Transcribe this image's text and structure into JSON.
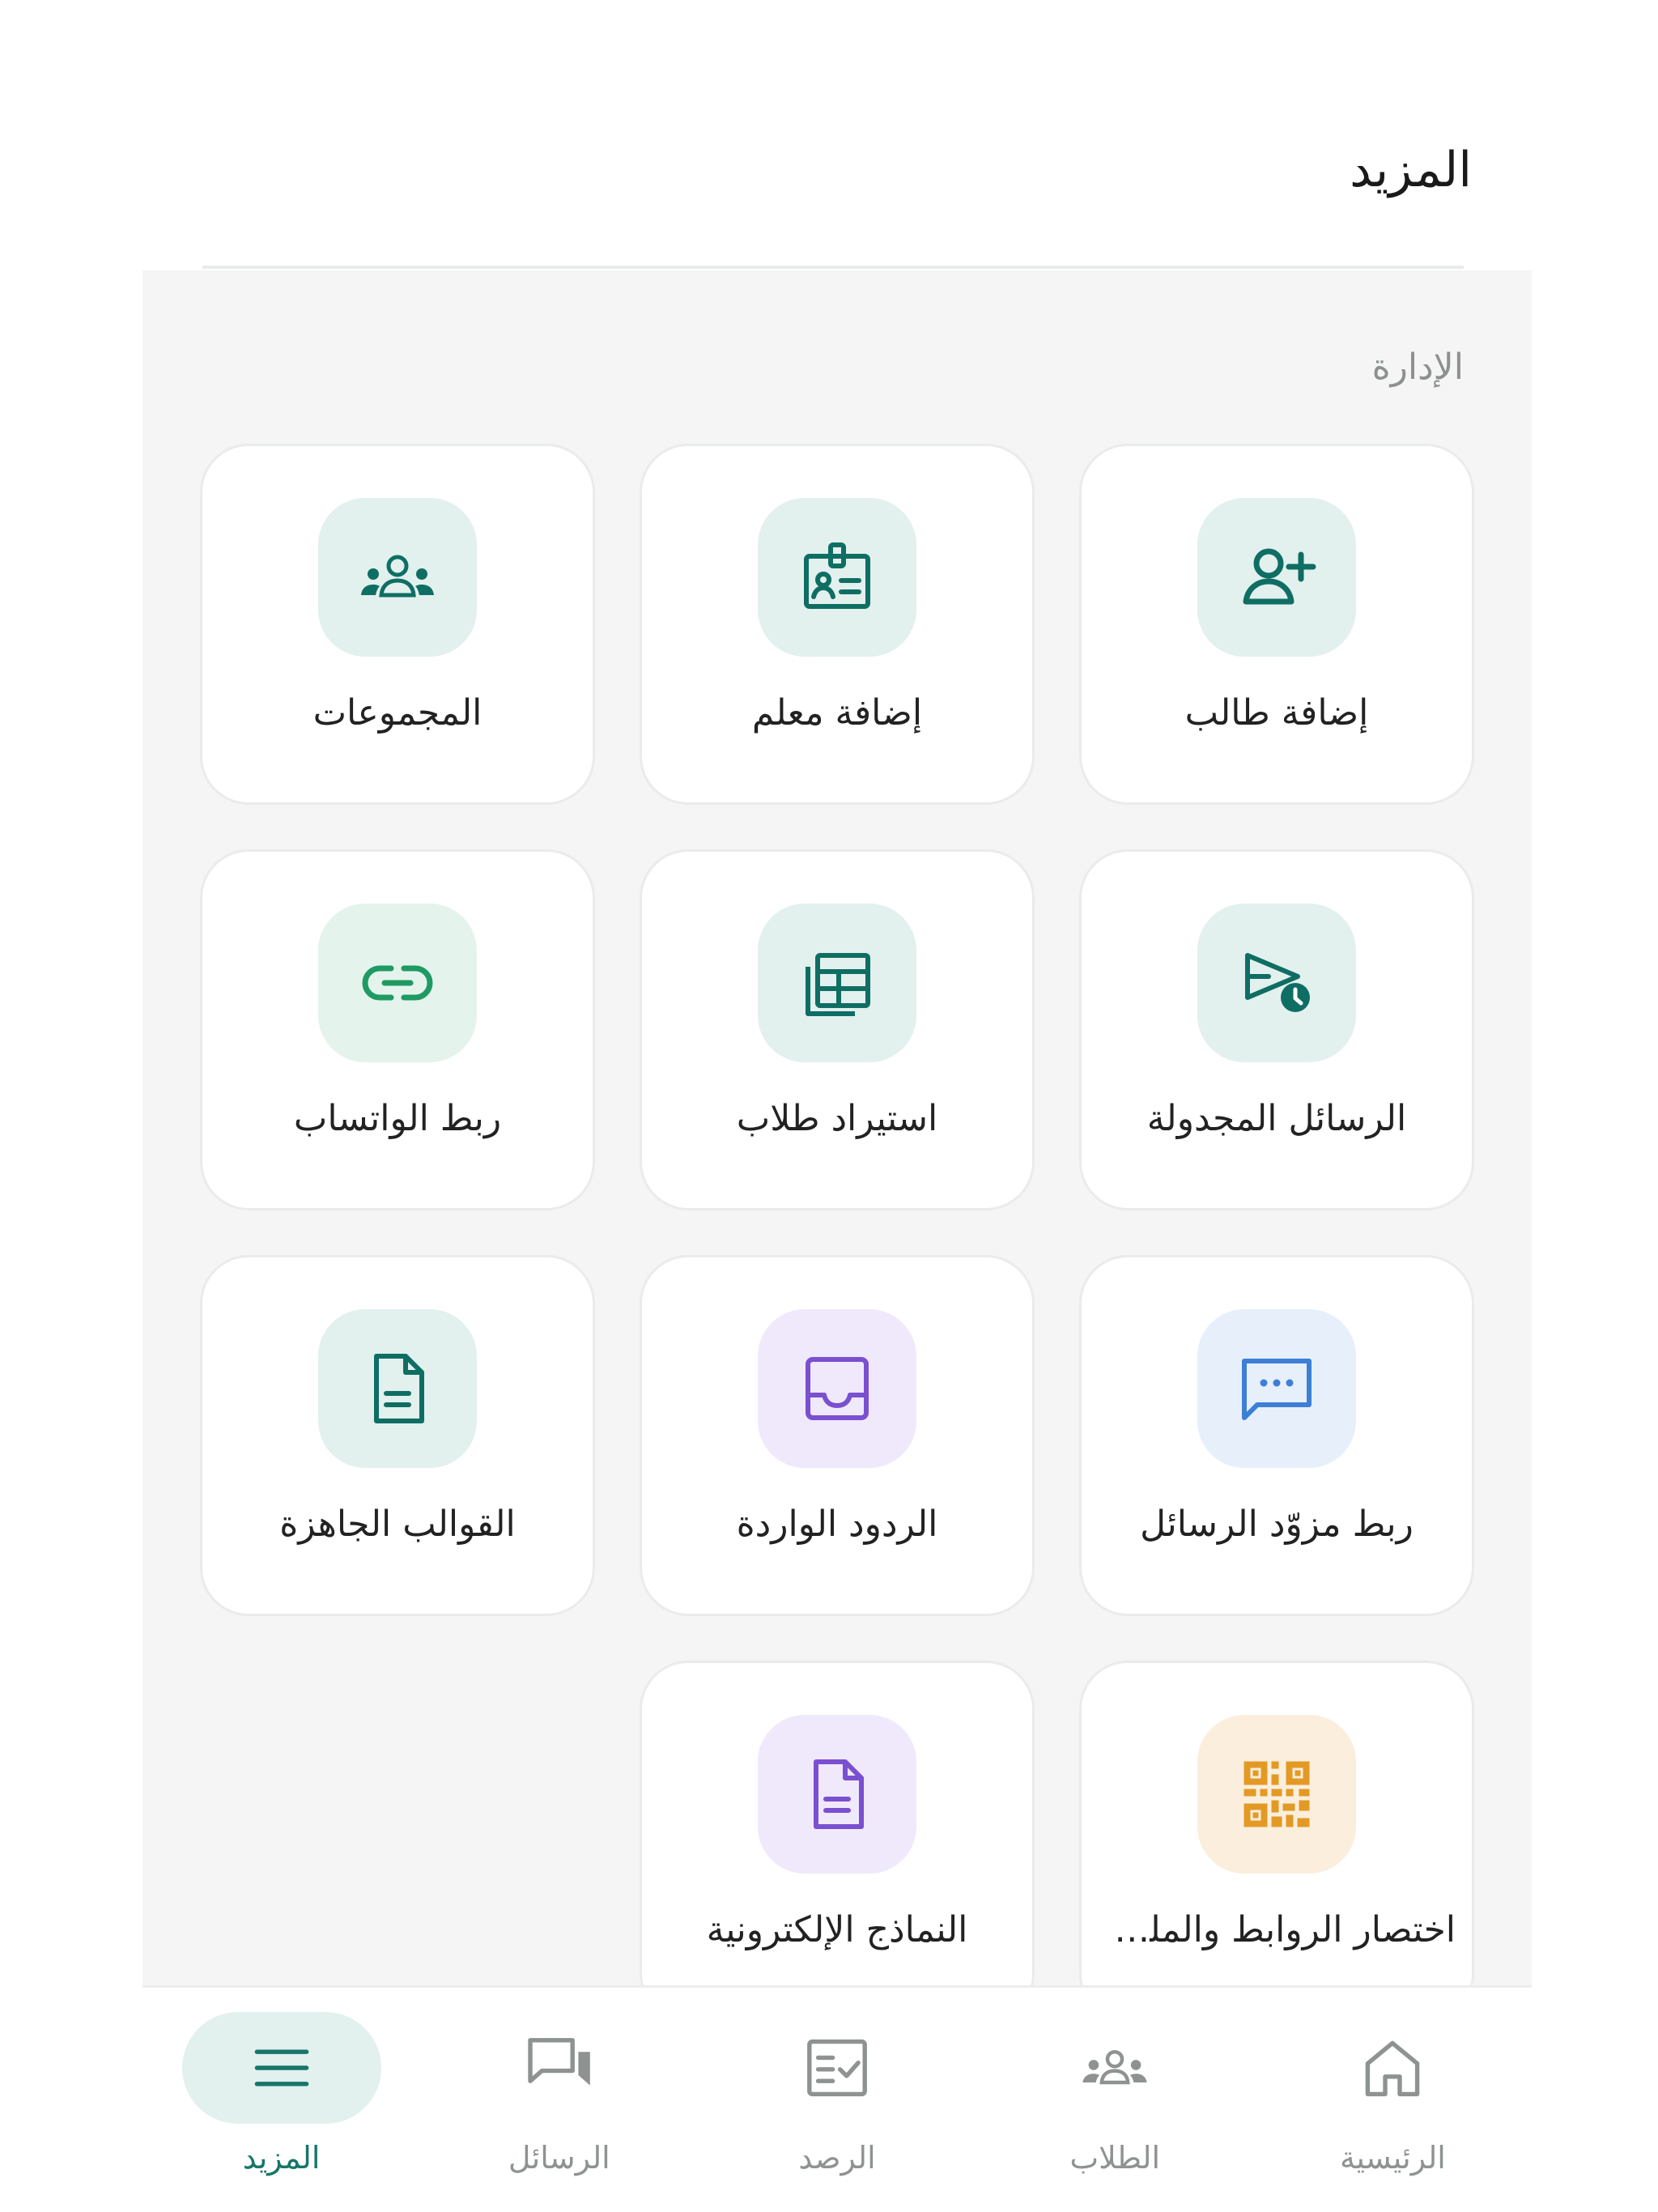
{
  "header": {
    "title": "المزيد"
  },
  "section": {
    "title": "الإدارة"
  },
  "cards": [
    {
      "label": "إضافة طالب",
      "icon": "add-student-icon",
      "tile": "#e2f0ee",
      "color": "#0f6e63"
    },
    {
      "label": "إضافة معلم",
      "icon": "id-badge-icon",
      "tile": "#e2f0ee",
      "color": "#0f6e63"
    },
    {
      "label": "المجموعات",
      "icon": "groups-icon",
      "tile": "#e2f0ee",
      "color": "#0f6e63"
    },
    {
      "label": "الرسائل المجدولة",
      "icon": "scheduled-send-icon",
      "tile": "#e2f0ee",
      "color": "#0f6e63"
    },
    {
      "label": "استيراد طلاب",
      "icon": "table-import-icon",
      "tile": "#e2f0ee",
      "color": "#0f6e63"
    },
    {
      "label": "ربط الواتساب",
      "icon": "link-icon",
      "tile": "#e4f4ec",
      "color": "#1f9a63"
    },
    {
      "label": "ربط مزوّد الرسائل",
      "icon": "chat-dots-icon",
      "tile": "#e7effb",
      "color": "#3d7fd6"
    },
    {
      "label": "الردود الواردة",
      "icon": "inbox-icon",
      "tile": "#efe9fb",
      "color": "#7a4fd0"
    },
    {
      "label": "القوالب الجاهزة",
      "icon": "document-icon",
      "tile": "#e2f0ee",
      "color": "#0f6e63"
    },
    {
      "label": "اختصار الروابط والملفات",
      "icon": "qr-code-icon",
      "tile": "#fbeedd",
      "color": "#e39a25"
    },
    {
      "label": "النماذج الإلكترونية",
      "icon": "form-document-icon",
      "tile": "#efe9fb",
      "color": "#7a4fd0"
    }
  ],
  "nav": {
    "items": [
      {
        "label": "الرئيسية",
        "icon": "home-icon",
        "active": false
      },
      {
        "label": "الطلاب",
        "icon": "students-icon",
        "active": false
      },
      {
        "label": "الرصد",
        "icon": "checklist-icon",
        "active": false
      },
      {
        "label": "الرسائل",
        "icon": "messages-icon",
        "active": false
      },
      {
        "label": "المزيد",
        "icon": "menu-icon",
        "active": true
      }
    ],
    "active_color": "#17756a",
    "inactive_color": "#8e9391"
  }
}
